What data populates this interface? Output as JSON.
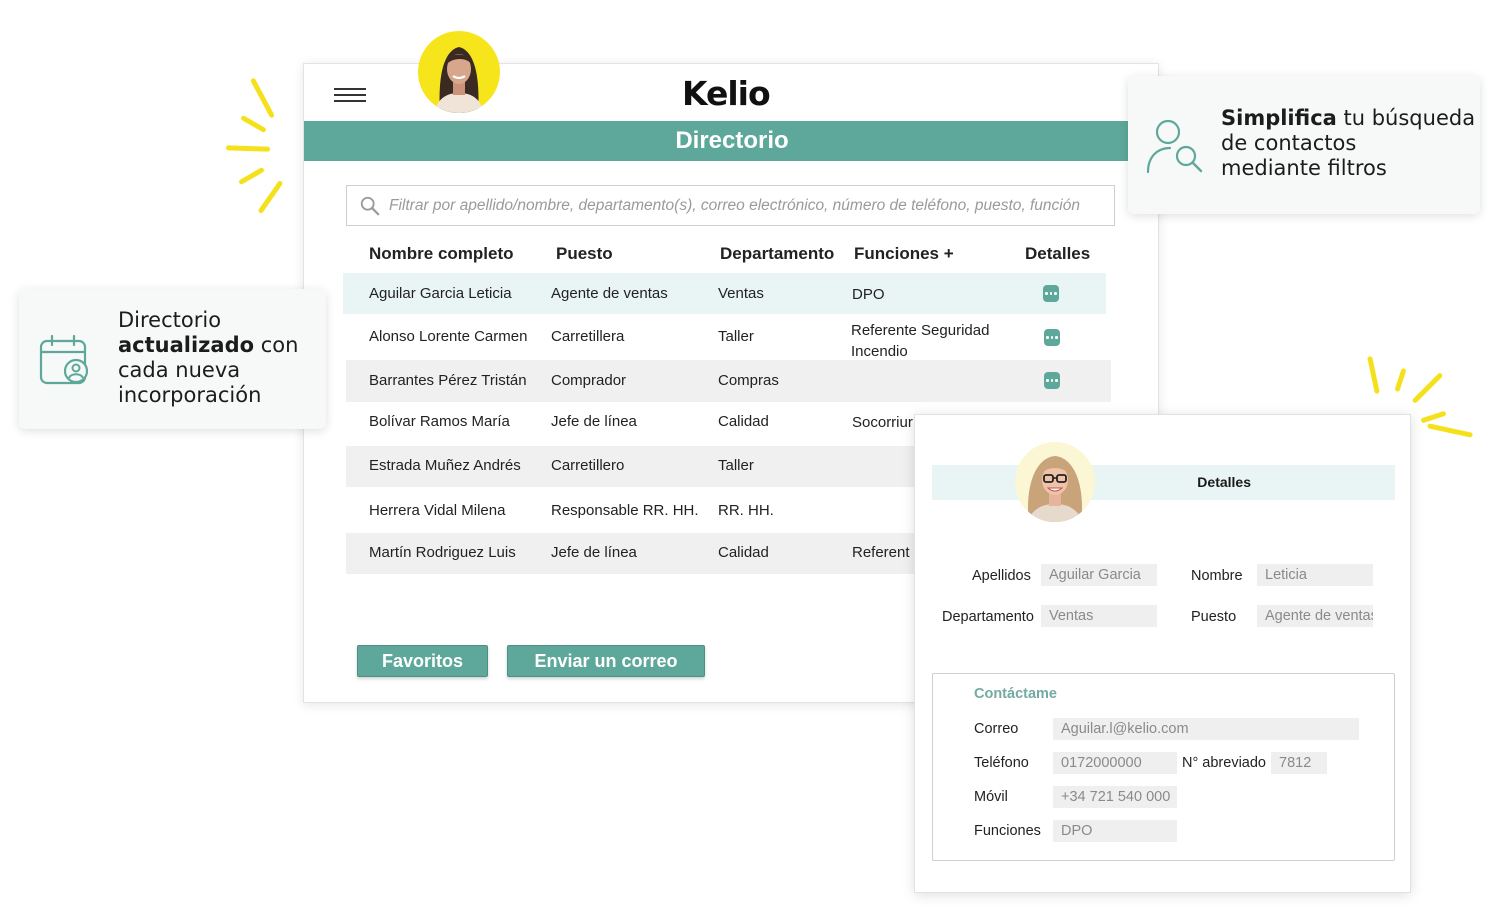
{
  "app": {
    "logo": "Kelio",
    "title": "Directorio"
  },
  "search": {
    "placeholder": "Filtrar por apellido/nombre, departamento(s), correo electrónico, número de teléfono, puesto, función"
  },
  "table": {
    "columns": [
      "Nombre completo",
      "Puesto",
      "Departamento",
      "Funciones +",
      "Detalles"
    ],
    "rows": [
      {
        "nombre": "Aguilar Garcia Leticia",
        "puesto": "Agente de ventas",
        "departamento": "Ventas",
        "funciones": "DPO"
      },
      {
        "nombre": "Alonso Lorente Carmen",
        "puesto": "Carretillera",
        "departamento": "Taller",
        "funciones": "Referente Seguridad Incendio"
      },
      {
        "nombre": "Barrantes Pérez Tristán",
        "puesto": "Comprador",
        "departamento": "Compras",
        "funciones": ""
      },
      {
        "nombre": "Bolívar Ramos María",
        "puesto": "Jefe de línea",
        "departamento": "Calidad",
        "funciones": "Socorriur"
      },
      {
        "nombre": "Estrada Muñez Andrés",
        "puesto": "Carretillero",
        "departamento": "Taller",
        "funciones": ""
      },
      {
        "nombre": "Herrera Vidal Milena",
        "puesto": "Responsable RR. HH.",
        "departamento": "RR. HH.",
        "funciones": ""
      },
      {
        "nombre": "Martín Rodriguez Luis",
        "puesto": "Jefe de línea",
        "departamento": "Calidad",
        "funciones": "Referent"
      }
    ]
  },
  "buttons": {
    "favoritos": "Favoritos",
    "enviar": "Enviar un correo"
  },
  "callout_left": {
    "line1": "Directorio",
    "line2_bold": "actualizado",
    "line2_rest": " con",
    "line3": "cada nueva",
    "line4": "incorporación"
  },
  "callout_right": {
    "bold": "Simplifica",
    "line1_rest": " tu búsqueda",
    "line2": "de contactos",
    "line3": "mediante filtros"
  },
  "details": {
    "header": "Detalles",
    "apellidos_label": "Apellidos",
    "apellidos_value": "Aguilar Garcia",
    "nombre_label": "Nombre",
    "nombre_value": "Leticia",
    "departamento_label": "Departamento",
    "departamento_value": "Ventas",
    "puesto_label": "Puesto",
    "puesto_value": "Agente de ventas",
    "contact_title": "Contáctame",
    "correo_label": "Correo",
    "correo_value": "Aguilar.l@kelio.com",
    "telefono_label": "Teléfono",
    "telefono_value": "0172000000",
    "abreviado_label": "N° abreviado",
    "abreviado_value": "7812",
    "movil_label": "Móvil",
    "movil_value": "+34 721 540 000",
    "funciones_label": "Funciones",
    "funciones_value": "DPO"
  },
  "colors": {
    "accent": "#5ea89b",
    "highlight_row": "#e9f5f4",
    "brand_yellow": "#f5e11b"
  }
}
